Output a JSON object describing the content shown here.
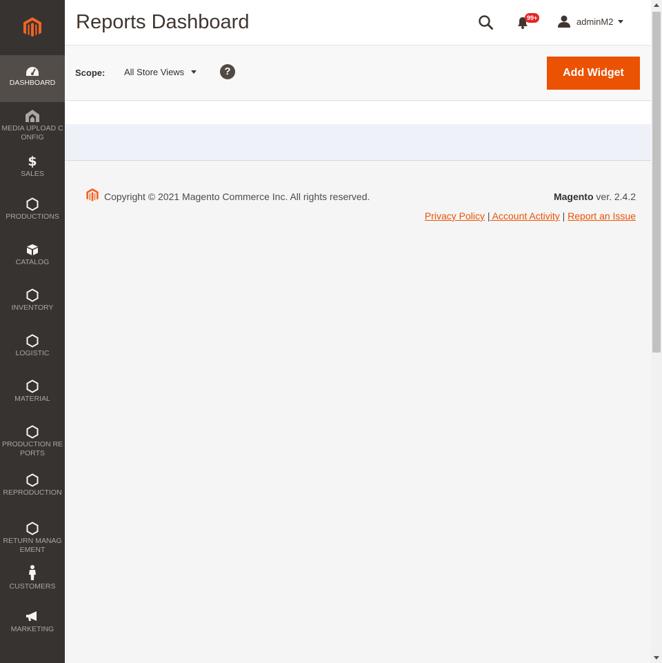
{
  "colors": {
    "accent": "#eb5202",
    "sidebar_bg": "#373330",
    "badge": "#e22626"
  },
  "header": {
    "title": "Reports Dashboard",
    "notifications_count": "99+",
    "username": "adminM2"
  },
  "sidebar": {
    "items": [
      {
        "label": "DASHBOARD",
        "icon": "dashboard-gauge-icon"
      },
      {
        "label": "MEDIA UPLOAD CONFIG",
        "icon": "upload-icon"
      },
      {
        "label": "SALES",
        "icon": "dollar-icon"
      },
      {
        "label": "PRODUCTIONS",
        "icon": "hexagon-icon"
      },
      {
        "label": "CATALOG",
        "icon": "box-icon"
      },
      {
        "label": "INVENTORY",
        "icon": "hexagon-icon"
      },
      {
        "label": "LOGISTIC",
        "icon": "hexagon-icon"
      },
      {
        "label": "MATERIAL",
        "icon": "hexagon-icon"
      },
      {
        "label": "PRODUCTION REPORTS",
        "icon": "hexagon-icon"
      },
      {
        "label": "REPRODUCTION",
        "icon": "hexagon-icon"
      },
      {
        "label": "RETURN MANAGEMENT",
        "icon": "hexagon-icon"
      },
      {
        "label": "CUSTOMERS",
        "icon": "person-icon"
      },
      {
        "label": "MARKETING",
        "icon": "megaphone-icon"
      }
    ]
  },
  "scope": {
    "label": "Scope:",
    "value": "All Store Views",
    "help": "?"
  },
  "actions": {
    "add_widget": "Add Widget"
  },
  "footer": {
    "copyright": "Copyright © 2021 Magento Commerce Inc. All rights reserved.",
    "brand": "Magento",
    "version": " ver. 2.4.2",
    "links": {
      "privacy": "Privacy Policy",
      "account_activity": " Account Activity",
      "report_issue": "Report an Issue"
    },
    "separator": "|"
  }
}
